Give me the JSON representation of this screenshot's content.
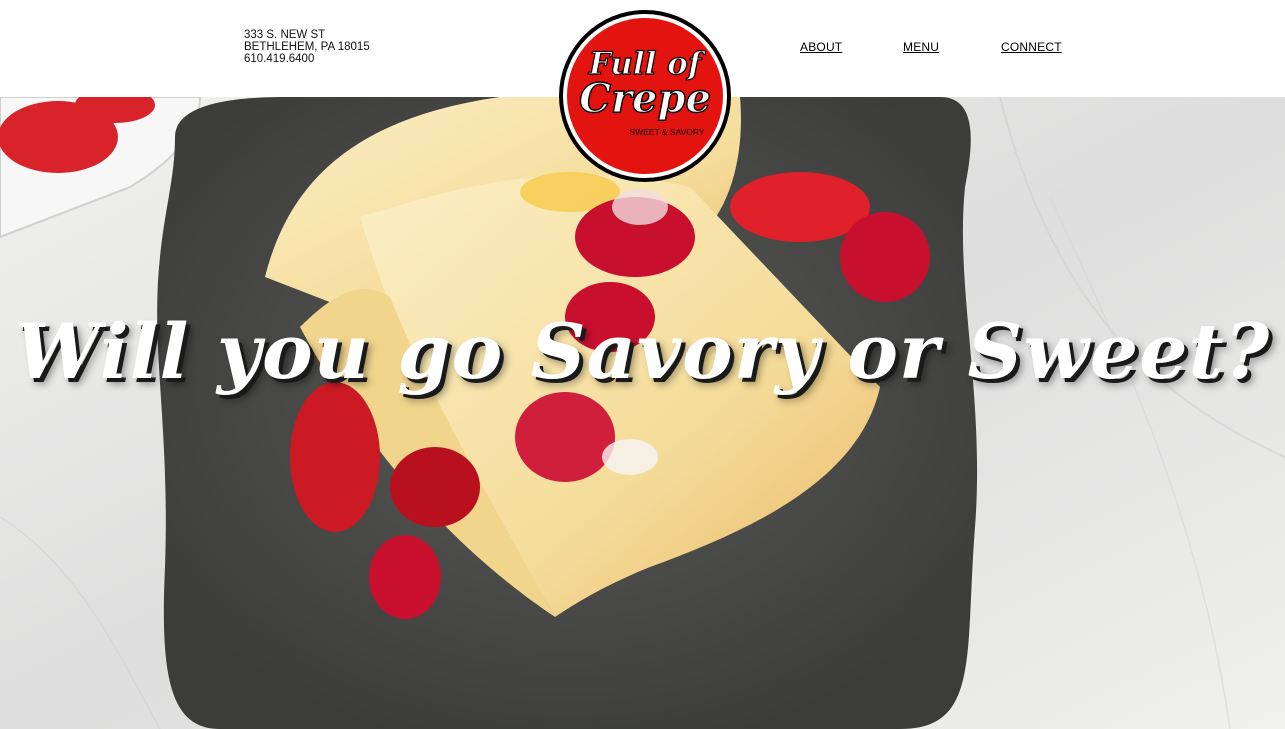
{
  "header": {
    "address_line1": "333 S. NEW ST",
    "address_line2": "BETHLEHEM, PA 18015",
    "phone": "610.419.6400",
    "logo": {
      "icon": "full-of-crepe-logo",
      "title_line1": "Full of",
      "title_line2": "Crepe",
      "tagline": "SWEET & SAVORY",
      "color": "#e3140f"
    },
    "nav": [
      {
        "label": "ABOUT"
      },
      {
        "label": "MENU"
      },
      {
        "label": "CONNECT"
      }
    ]
  },
  "hero": {
    "headline": "Will you go Savory or Sweet?",
    "image": "crepes-with-berries-photo"
  }
}
